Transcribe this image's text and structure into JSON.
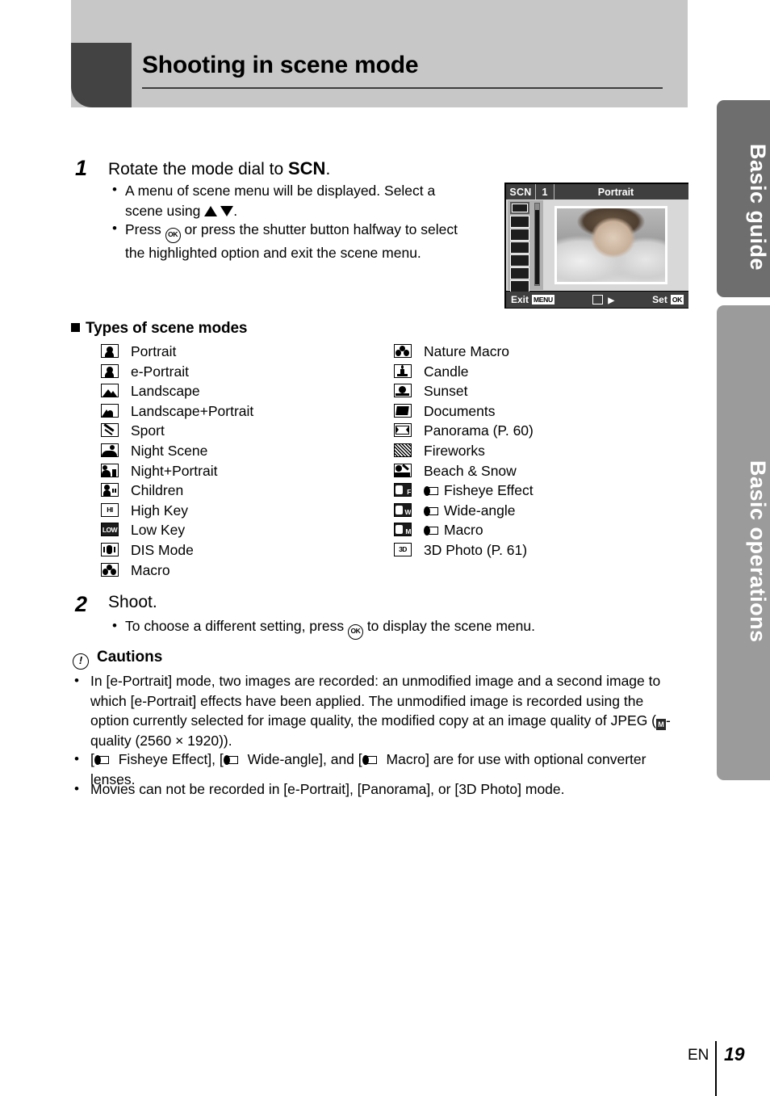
{
  "header": {
    "title": "Shooting in scene mode"
  },
  "side_tabs": [
    {
      "label": "Basic guide"
    },
    {
      "label": "Basic operations"
    }
  ],
  "step1": {
    "number": "1",
    "title_pre": "Rotate the mode dial to ",
    "title_bold": "SCN",
    "title_post": ".",
    "bullet_mark": "•",
    "b1_pre": "A menu of scene menu will be displayed. Select a scene using ",
    "b1_post": ".",
    "b2_pre": "Press ",
    "b2_ok": "OK",
    "b2_post": " or press the shutter button halfway to select the highlighted option and exit the scene menu."
  },
  "lcd": {
    "mode_badge": "SCN",
    "index": "1",
    "scene_name": "Portrait",
    "exit_label": "Exit",
    "exit_key": "MENU",
    "set_label": "Set",
    "set_key": "OK",
    "arrow": "▶",
    "sidebar_icons": [
      "portrait",
      "e-portrait",
      "landscape",
      "landscape-portrait",
      "sport",
      "night-scene",
      "night-portrait"
    ]
  },
  "scene_section": {
    "heading": "Types of scene modes",
    "left_column": [
      {
        "icon": "portrait",
        "label": "Portrait",
        "icon_text": ""
      },
      {
        "icon": "e-portrait",
        "label": "e-Portrait",
        "icon_text": ""
      },
      {
        "icon": "landscape",
        "label": "Landscape",
        "icon_text": ""
      },
      {
        "icon": "landscape-portrait",
        "label": "Landscape+Portrait",
        "icon_text": ""
      },
      {
        "icon": "sport",
        "label": "Sport",
        "icon_text": ""
      },
      {
        "icon": "night-scene",
        "label": "Night Scene",
        "icon_text": ""
      },
      {
        "icon": "night-portrait",
        "label": "Night+Portrait",
        "icon_text": ""
      },
      {
        "icon": "children",
        "label": "Children",
        "icon_text": ""
      },
      {
        "icon": "high-key",
        "label": "High Key",
        "icon_text": "HI"
      },
      {
        "icon": "low-key",
        "label": "Low Key",
        "icon_text": "LOW"
      },
      {
        "icon": "dis-mode",
        "label": "DIS Mode",
        "icon_text": ""
      },
      {
        "icon": "macro",
        "label": "Macro",
        "icon_text": ""
      }
    ],
    "right_column": [
      {
        "icon": "nature-macro",
        "label": "Nature Macro",
        "icon_text": "",
        "lens": false
      },
      {
        "icon": "candle",
        "label": "Candle",
        "icon_text": "",
        "lens": false
      },
      {
        "icon": "sunset",
        "label": "Sunset",
        "icon_text": "",
        "lens": false
      },
      {
        "icon": "documents",
        "label": "Documents",
        "icon_text": "",
        "lens": false
      },
      {
        "icon": "panorama",
        "label": "Panorama (P. 60)",
        "icon_text": "",
        "lens": false
      },
      {
        "icon": "fireworks",
        "label": "Fireworks",
        "icon_text": "",
        "lens": false
      },
      {
        "icon": "beach-snow",
        "label": "Beach & Snow",
        "icon_text": "",
        "lens": false
      },
      {
        "icon": "fisheye-effect",
        "label": "Fisheye Effect",
        "icon_text": "F",
        "lens": true
      },
      {
        "icon": "wide-angle",
        "label": "Wide-angle",
        "icon_text": "W",
        "lens": true
      },
      {
        "icon": "converter-macro",
        "label": "Macro",
        "icon_text": "M",
        "lens": true
      },
      {
        "icon": "3d-photo",
        "label": "3D Photo (P. 61)",
        "icon_text": "3D",
        "lens": false
      }
    ]
  },
  "step2": {
    "number": "2",
    "title": "Shoot.",
    "bullet_mark": "•",
    "b1_pre": "To choose a different setting, press ",
    "b1_ok": "OK",
    "b1_post": " to display the scene menu."
  },
  "cautions": {
    "heading": "Cautions",
    "icon": "!",
    "bullet_mark": "•",
    "item1_a": "In [e-Portrait] mode, two images are recorded: an unmodified image and a second image to which [e-Portrait] effects have been applied. The unmodified image is recorded using the option currently selected for image quality, the modified copy at an image quality of JPEG (",
    "item1_badge": "M",
    "item1_b": "-quality (2560 × 1920)).",
    "item2_a": "[",
    "item2_b": " Fisheye Effect], [",
    "item2_c": " Wide-angle], and [",
    "item2_d": " Macro] are for use with optional converter lenses.",
    "item3": "Movies can not be recorded in [e-Portrait], [Panorama], or [3D Photo] mode."
  },
  "footer": {
    "language": "EN",
    "page_number": "19"
  }
}
